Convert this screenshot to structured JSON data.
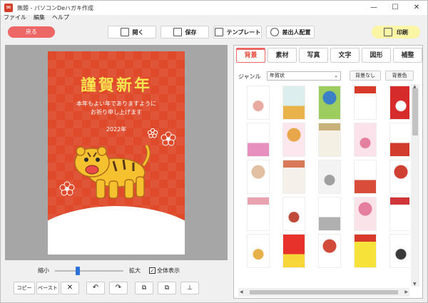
{
  "window": {
    "title": "無題 - パソコンDeハガキ作成",
    "controls": [
      "minimize",
      "maximize",
      "close"
    ]
  },
  "menu": [
    "ファイル",
    "編集",
    "ヘルプ"
  ],
  "toolbar": {
    "back_label": "戻る",
    "open_label": "開く",
    "save_label": "保存",
    "template_label": "テンプレート",
    "sender_label": "差出人配置",
    "print_label": "印刷"
  },
  "card": {
    "title": "謹賀新年",
    "message_line1": "本年もよい年でありますように",
    "message_line2": "お祈り申し上げます",
    "year": "2022年"
  },
  "zoom": {
    "small_label": "縮小",
    "big_label": "拡大",
    "fit_label": "全体表示",
    "fit_checked": true
  },
  "edit_buttons": {
    "copy": "コピー",
    "paste": "ペースト"
  },
  "panel": {
    "tabs": [
      "背景",
      "素材",
      "写真",
      "文字",
      "図形",
      "補整"
    ],
    "active_tab": "背景",
    "genre_label": "ジャンル",
    "genre_value": "年賀状",
    "no_bg_label": "背景なし",
    "bg_color_label": "背景色"
  },
  "thumbnails": [
    {
      "bg": "#ffffff",
      "accent": "#e8a9a0"
    },
    {
      "bg": "#dcefee",
      "accent": "#e9b24a"
    },
    {
      "bg": "#9ccd5e",
      "accent": "#3b7fc7"
    },
    {
      "bg": "#ffffff",
      "accent": "#d93b2b"
    },
    {
      "bg": "#d62b2b",
      "accent": "#ffffff"
    },
    {
      "bg": "#ffffff",
      "accent": "#e78fbe"
    },
    {
      "bg": "#fde7ef",
      "accent": "#e8a74a"
    },
    {
      "bg": "#f4f1e4",
      "accent": "#c9b27a"
    },
    {
      "bg": "#fbe2ea",
      "accent": "#e57fa0"
    },
    {
      "bg": "#ffffff",
      "accent": "#d23c2c"
    },
    {
      "bg": "#ffffff",
      "accent": "#e0c0a0"
    },
    {
      "bg": "#f5f0ea",
      "accent": "#d87a5a"
    },
    {
      "bg": "#f3f3f3",
      "accent": "#a0a0a0"
    },
    {
      "bg": "#ffffff",
      "accent": "#d94c3a"
    },
    {
      "bg": "#ffffff",
      "accent": "#cf3f32"
    },
    {
      "bg": "#ffffff",
      "accent": "#e8a2b0"
    },
    {
      "bg": "#ffffff",
      "accent": "#c04a3a"
    },
    {
      "bg": "#ffffff",
      "accent": "#b0b0b0"
    },
    {
      "bg": "#fbe3ea",
      "accent": "#e57fa0"
    },
    {
      "bg": "#ffffff",
      "accent": "#d0353a"
    },
    {
      "bg": "#ffffff",
      "accent": "#e8b04a"
    },
    {
      "bg": "#e6322b",
      "accent": "#f7d63a"
    },
    {
      "bg": "#ffffff",
      "accent": "#d24a3a"
    },
    {
      "bg": "#f7e23a",
      "accent": "#d73a2b"
    },
    {
      "bg": "#ffffff",
      "accent": "#3a3a3a"
    }
  ]
}
